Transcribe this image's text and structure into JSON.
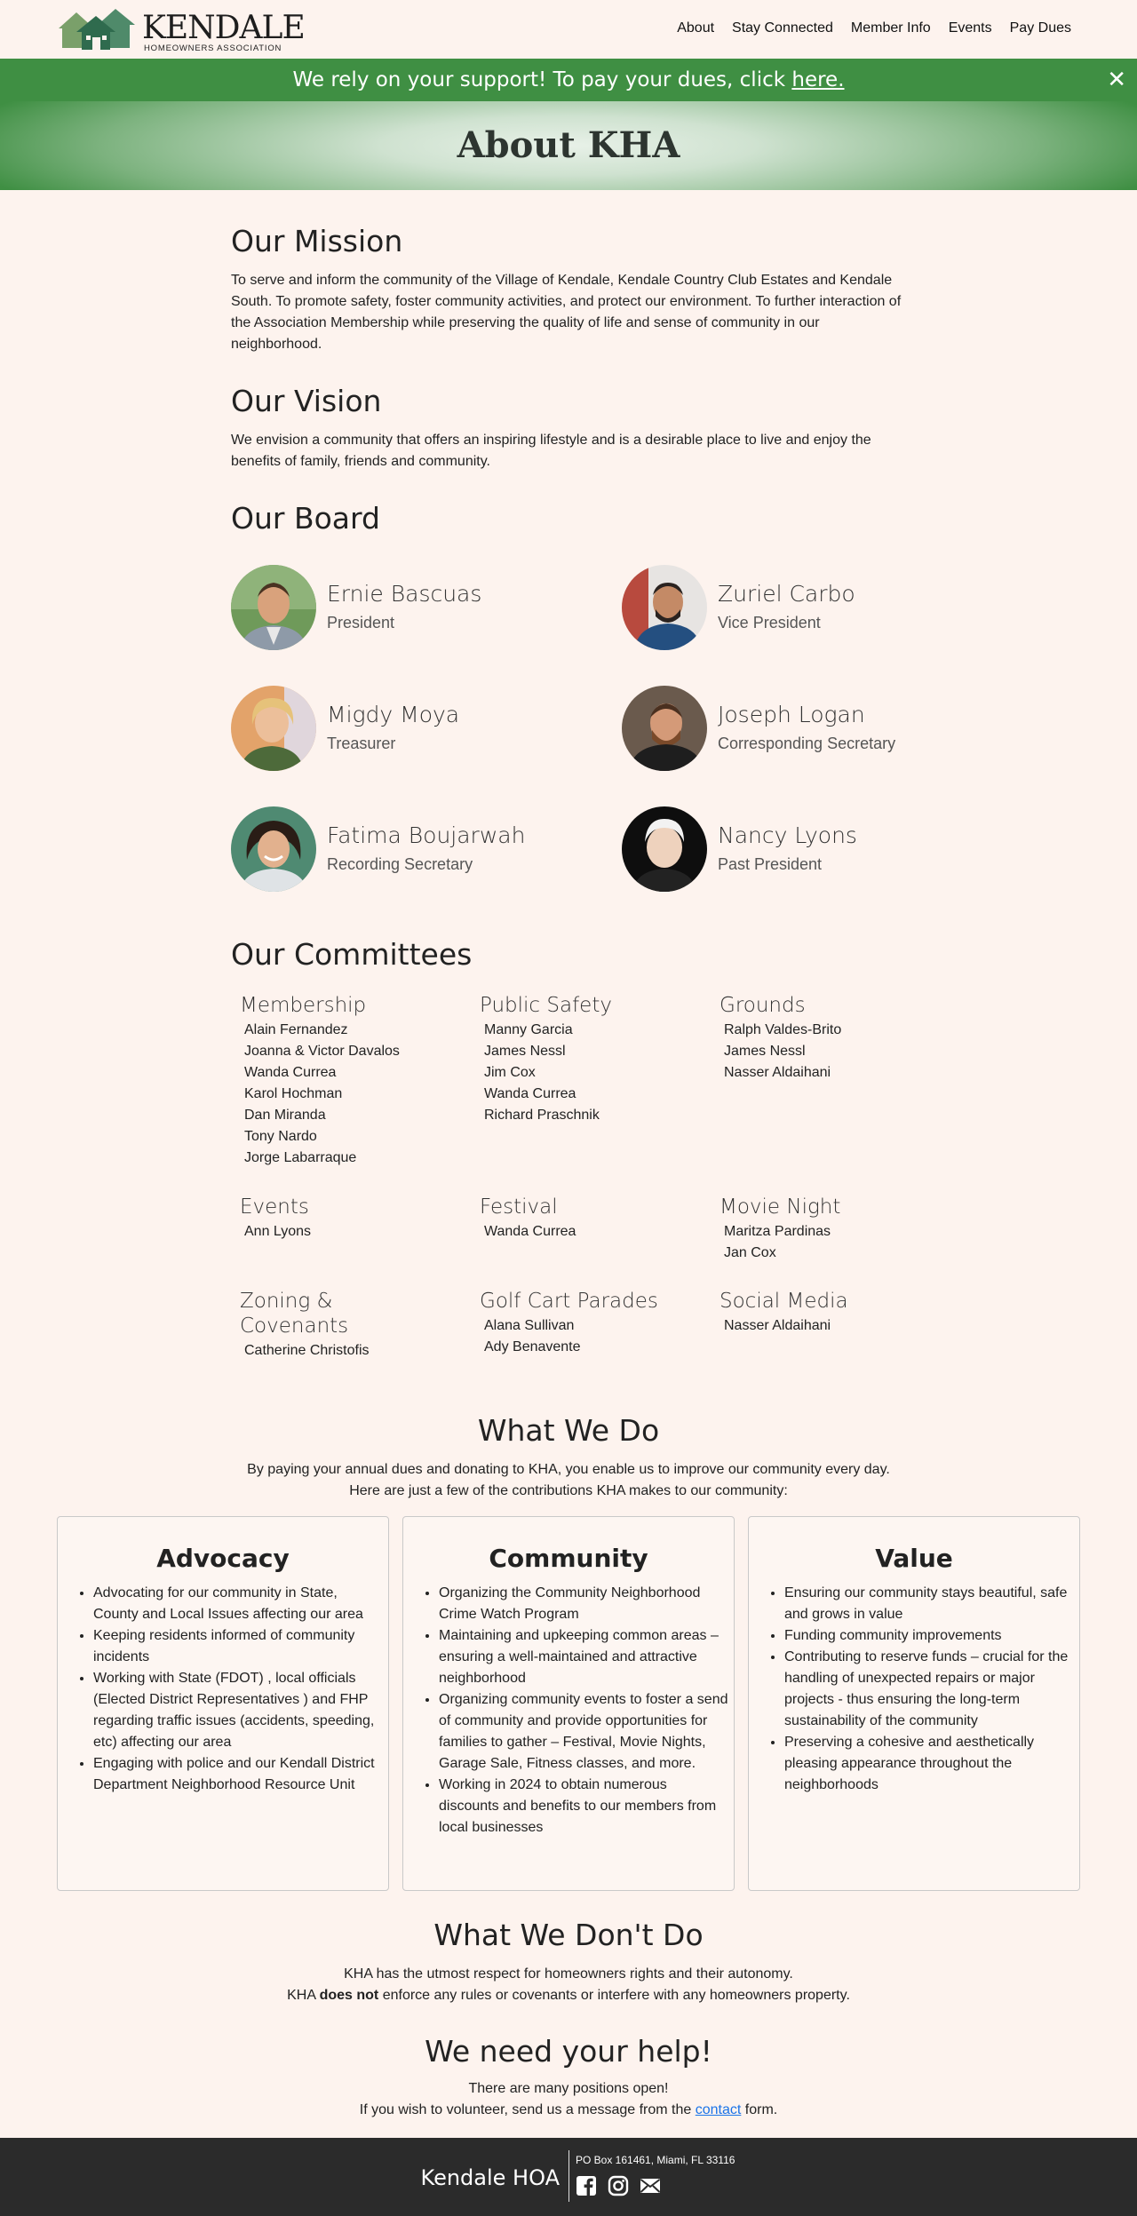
{
  "brand": {
    "name": "KENDALE",
    "tagline": "HOMEOWNERS ASSOCIATION",
    "green": "#3f8f43"
  },
  "nav": [
    "About",
    "Stay Connected",
    "Member Info",
    "Events",
    "Pay Dues"
  ],
  "banner": {
    "text": "We rely on your support! To pay your dues, click ",
    "link": "here.",
    "close": "✕"
  },
  "hero": {
    "title": "About KHA"
  },
  "mission": {
    "heading": "Our Mission",
    "text": "To serve and inform the community of the Village of Kendale, Kendale Country Club Estates and Kendale South. To promote safety, foster community activities, and protect our environment. To further interaction of the Association Membership while preserving the quality of life and sense of community in our neighborhood."
  },
  "vision": {
    "heading": "Our Vision",
    "text": "We envision a community that offers an inspiring lifestyle and is a desirable place to live and enjoy the benefits of family, friends and community."
  },
  "board": {
    "heading": "Our Board",
    "members": [
      {
        "name": "Ernie Bascuas",
        "role": "President"
      },
      {
        "name": "Zuriel Carbo",
        "role": "Vice President"
      },
      {
        "name": "Migdy Moya",
        "role": "Treasurer"
      },
      {
        "name": "Joseph Logan",
        "role": "Corresponding Secretary"
      },
      {
        "name": "Fatima Boujarwah",
        "role": "Recording Secretary"
      },
      {
        "name": "Nancy Lyons",
        "role": "Past President"
      }
    ]
  },
  "committees": {
    "heading": "Our Committees",
    "list": [
      {
        "name": "Membership",
        "members": [
          "Alain Fernandez",
          "Joanna & Victor Davalos",
          "Wanda Currea",
          "Karol Hochman",
          "Dan Miranda",
          "Tony Nardo",
          "Jorge Labarraque"
        ]
      },
      {
        "name": "Public Safety",
        "members": [
          "Manny Garcia",
          "James Nessl",
          "Jim Cox",
          "Wanda Currea",
          "Richard Praschnik"
        ]
      },
      {
        "name": "Grounds",
        "members": [
          "Ralph Valdes-Brito",
          "James Nessl",
          "Nasser Aldaihani"
        ]
      },
      {
        "name": "Events",
        "members": [
          "Ann Lyons"
        ]
      },
      {
        "name": "Festival",
        "members": [
          "Wanda Currea"
        ]
      },
      {
        "name": "Movie Night",
        "members": [
          "Maritza Pardinas",
          "Jan Cox"
        ]
      },
      {
        "name": "Zoning & Covenants",
        "members": [
          "Catherine Christofis"
        ]
      },
      {
        "name": "Golf Cart Parades",
        "members": [
          "Alana Sullivan",
          "Ady Benavente"
        ]
      },
      {
        "name": "Social Media",
        "members": [
          "Nasser Aldaihani"
        ]
      }
    ]
  },
  "whatwedo": {
    "heading": "What We Do",
    "line1": "By paying your annual dues and donating to KHA, you enable us to improve our community every day.",
    "line2": "Here are just a few of the contributions KHA makes to our community:",
    "cards": [
      {
        "title": "Advocacy",
        "items": [
          "Advocating for our community in State, County and Local Issues affecting our area",
          "Keeping residents informed of community incidents",
          "Working with State (FDOT) , local officials (Elected District Representatives ) and FHP regarding traffic issues (accidents, speeding, etc) affecting our area",
          "Engaging with police and our Kendall District Department Neighborhood Resource Unit"
        ]
      },
      {
        "title": "Community",
        "items": [
          "Organizing the Community Neighborhood Crime Watch Program",
          "Maintaining and upkeeping common areas – ensuring a well-maintained and attractive neighborhood",
          "Organizing community events to foster a send of community and provide opportunities for families to gather – Festival, Movie Nights, Garage Sale, Fitness classes, and more.",
          "Working in 2024 to obtain numerous discounts and benefits to our members from local businesses"
        ]
      },
      {
        "title": "Value",
        "items": [
          "Ensuring our community stays beautiful, safe and grows in value",
          "Funding community improvements",
          "Contributing to reserve funds – crucial for the handling of unexpected repairs or major projects - thus ensuring the long-term sustainability of the community",
          "Preserving a cohesive and aesthetically pleasing appearance throughout the neighborhoods"
        ]
      }
    ]
  },
  "dontdo": {
    "heading": "What We Don't Do",
    "line1": "KHA has the utmost respect for homeowners rights and their autonomy.",
    "line2_pre": "KHA ",
    "line2_bold": "does not",
    "line2_post": " enforce any rules or covenants or interfere with any homeowners property."
  },
  "help": {
    "heading": "We need your help!",
    "line1": "There are many positions open!",
    "line2_pre": "If you wish to volunteer, send us a message from the ",
    "link": "contact",
    "line2_post": " form."
  },
  "footer": {
    "title": "Kendale HOA",
    "address": "PO Box 161461, Miami, FL 33116",
    "icons": [
      "facebook-icon",
      "instagram-icon",
      "email-icon"
    ]
  }
}
